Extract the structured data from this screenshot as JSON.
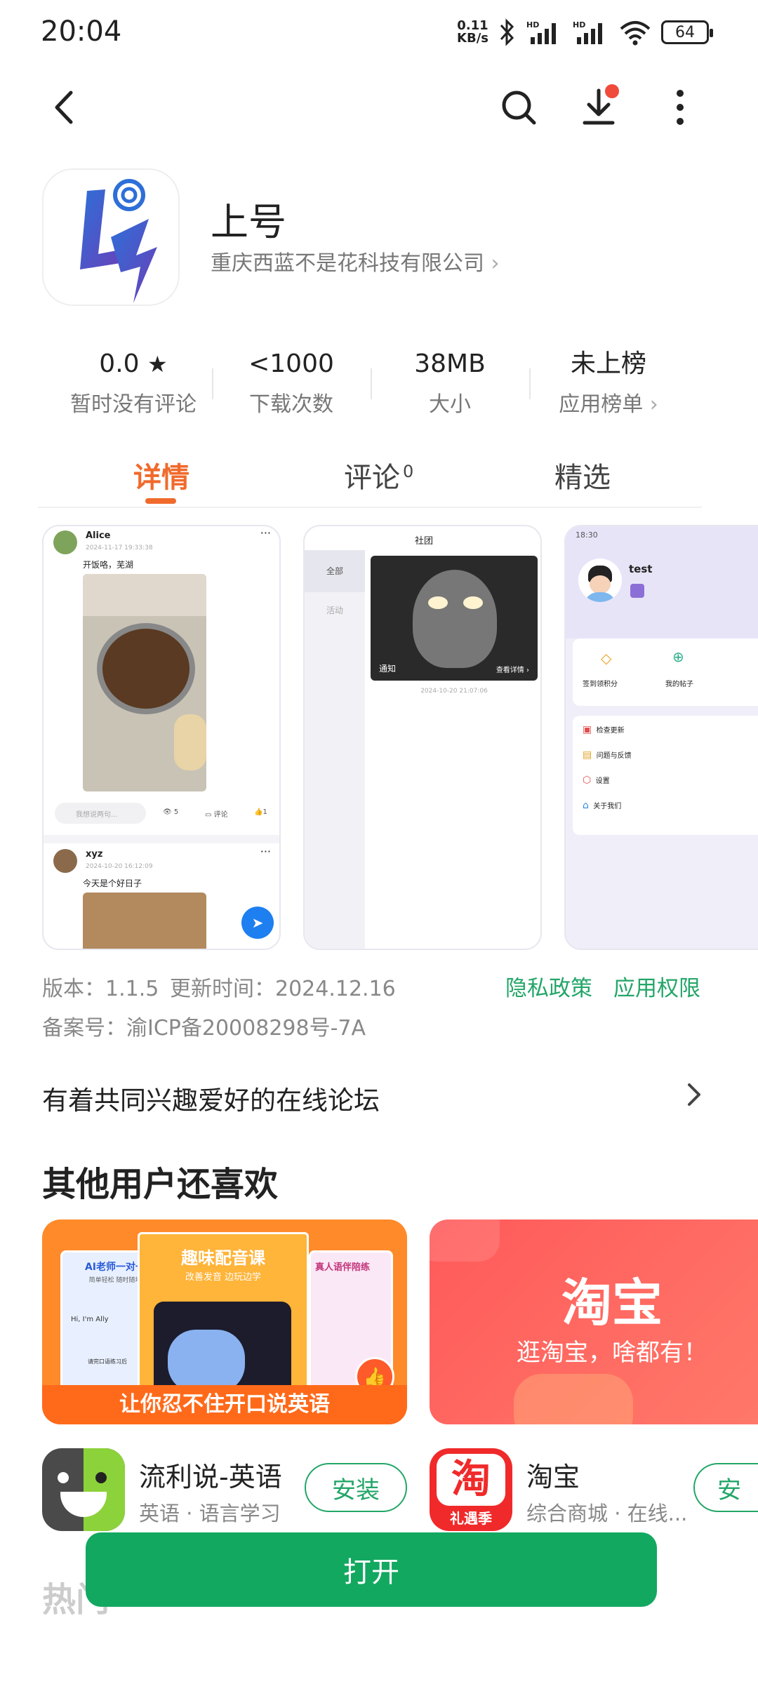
{
  "status_bar": {
    "time": "20:04",
    "net_speed_top": "0.11",
    "net_speed_bottom": "KB/s",
    "battery": "64"
  },
  "app": {
    "name": "上号",
    "developer": "重庆西蓝不是花科技有限公司"
  },
  "stats": [
    {
      "value": "0.0",
      "label": "暂时没有评论"
    },
    {
      "value": "<1000",
      "label": "下载次数"
    },
    {
      "value": "38MB",
      "label": "大小"
    },
    {
      "value": "未上榜",
      "label": "应用榜单"
    }
  ],
  "tabs": {
    "detail": "详情",
    "reviews": "评论",
    "reviews_count": "0",
    "featured": "精选"
  },
  "shot1": {
    "post1_user": "Alice",
    "post1_time": "2024-11-17 19:33:38",
    "post1_text": "开饭咯，芜湖",
    "comment_placeholder": "我想说两句...",
    "views": "5",
    "comment": "评论",
    "likes": "1",
    "post2_user": "xyz",
    "post2_time": "2024-10-20 16:12:09",
    "post2_text": "今天是个好日子"
  },
  "shot2": {
    "title": "社团",
    "menu_all": "全部",
    "menu_activity": "活动",
    "card_label": "通知",
    "card_more": "查看详情",
    "card_time": "2024-10-20 21:07:06"
  },
  "shot3": {
    "time": "18:30",
    "username": "test",
    "checkin": "签到领积分",
    "my_posts": "我的帖子",
    "menu": [
      "检查更新",
      "问题与反馈",
      "设置",
      "关于我们"
    ]
  },
  "info": {
    "version": "版本：1.1.5",
    "update_time": "更新时间：2024.12.16",
    "privacy": "隐私政策",
    "permissions": "应用权限",
    "icp": "备案号：渝ICP备20008298号-7A"
  },
  "description": "有着共同兴趣爱好的在线论坛",
  "section_title": "其他用户还喜欢",
  "recommend": [
    {
      "name": "流利说-英语",
      "sub": "英语 · 语言学习",
      "install": "安装",
      "banner_main": "趣味配音课",
      "banner_sub": "改善发音 边玩边学",
      "banner_left": "AI老师一对一",
      "banner_left_sub": "简单轻松 随时随地",
      "banner_hi": "Hi, I'm Ally",
      "banner_right": "真人语伴陪练",
      "banner_bottom": "让你忍不住开口说英语",
      "banner_small": "请完口语练习后"
    },
    {
      "name": "淘宝",
      "sub": "综合商城 · 在线...",
      "install": "安",
      "banner_main": "淘宝",
      "banner_sub": "逛淘宝，啥都有！",
      "icon_text": "淘",
      "icon_sub": "礼遇季"
    }
  ],
  "open_button": "打开",
  "hot_section_partial": "热门"
}
